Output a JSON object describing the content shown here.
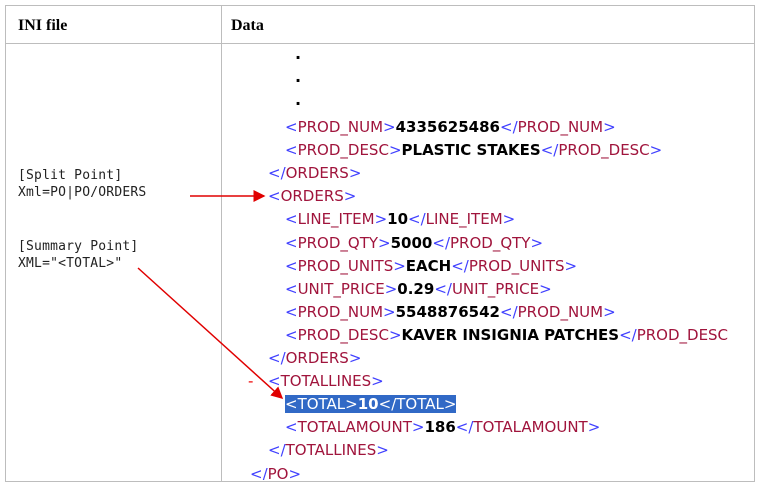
{
  "headers": {
    "ini": "INI file",
    "data": "Data"
  },
  "ini": {
    "split_label": "[Split Point]",
    "split_value": "Xml=PO|PO/ORDERS",
    "summary_label": "[Summary Point]",
    "summary_value": "XML=\"<TOTAL>\""
  },
  "ellipsis": [
    ".",
    ".",
    "."
  ],
  "xml_lines": [
    {
      "indent": 2,
      "tag": "PROD_NUM",
      "value": "4335625486",
      "close": "PROD_NUM"
    },
    {
      "indent": 2,
      "tag": "PROD_DESC",
      "value": "PLASTIC STAKES",
      "close": "PROD_DESC"
    },
    {
      "indent": 1,
      "endtag": "ORDERS"
    },
    {
      "indent": 1,
      "tag": "ORDERS"
    },
    {
      "indent": 2,
      "tag": "LINE_ITEM",
      "value": "10",
      "close": "LINE_ITEM"
    },
    {
      "indent": 2,
      "tag": "PROD_QTY",
      "value": "5000",
      "close": "PROD_QTY"
    },
    {
      "indent": 2,
      "tag": "PROD_UNITS",
      "value": "EACH",
      "close": "PROD_UNITS"
    },
    {
      "indent": 2,
      "tag": "UNIT_PRICE",
      "value": "0.29",
      "close": "UNIT_PRICE"
    },
    {
      "indent": 2,
      "tag": "PROD_NUM",
      "value": "5548876542",
      "close": "PROD_NUM"
    },
    {
      "indent": 2,
      "tag": "PROD_DESC",
      "value": "KAVER INSIGNIA PATCHES",
      "close": "PROD_DESC"
    },
    {
      "indent": 1,
      "endtag": "ORDERS"
    },
    {
      "indent": 1,
      "tag": "TOTALLINES",
      "collapse": "-"
    },
    {
      "indent": 2,
      "tag": "TOTAL",
      "value": "10",
      "close": "TOTAL",
      "highlight": true
    },
    {
      "indent": 2,
      "tag": "TOTALAMOUNT",
      "value": "186",
      "close": "TOTALAMOUNT"
    },
    {
      "indent": 1,
      "endtag": "TOTALLINES"
    },
    {
      "indent": 0,
      "endtag": "PO"
    }
  ],
  "colors": {
    "bracket": "#4040ff",
    "tag": "#a0143c",
    "highlight": "#3169c6",
    "arrow": "#e00000"
  }
}
